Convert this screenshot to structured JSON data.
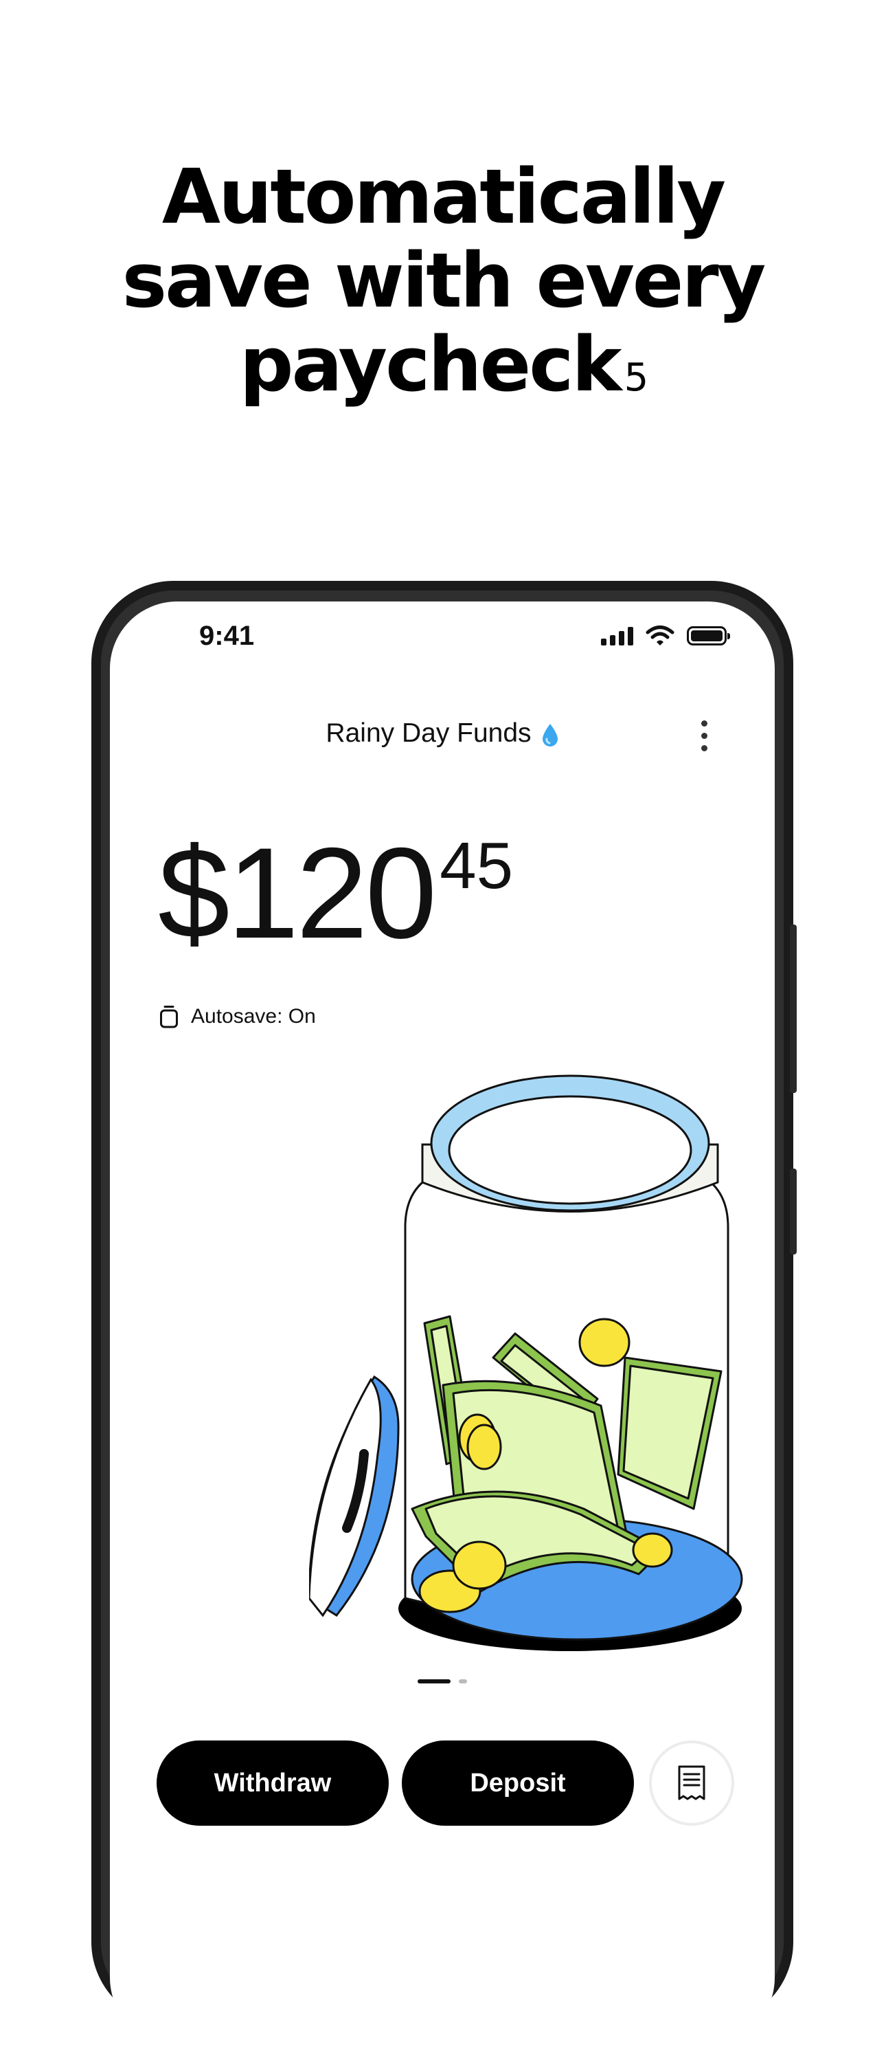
{
  "promo": {
    "line1": "Automatically",
    "line2": "save with every",
    "line3": "paycheck",
    "footnote": "5"
  },
  "status_bar": {
    "time": "9:41",
    "icons": [
      "signal-icon",
      "wifi-icon",
      "battery-icon"
    ]
  },
  "account": {
    "title": "Rainy Day Funds",
    "title_icon": "water-drop-icon",
    "menu_icon": "more-vertical-icon",
    "balance_dollars": "$120",
    "balance_cents": "45",
    "autosave_label": "Autosave: On",
    "autosave_icon": "jar-icon"
  },
  "pager": {
    "pages": 2,
    "active": 1
  },
  "actions": {
    "withdraw_label": "Withdraw",
    "deposit_label": "Deposit",
    "receipt_icon": "receipt-icon"
  },
  "colors": {
    "button_bg": "#000000",
    "jar_lid_ring": "#a6d8f5",
    "jar_lid_blue": "#4f9bef",
    "cash_green": "#8cc44e",
    "cash_light": "#e3f7b8",
    "coin_yellow": "#f9e43b"
  }
}
